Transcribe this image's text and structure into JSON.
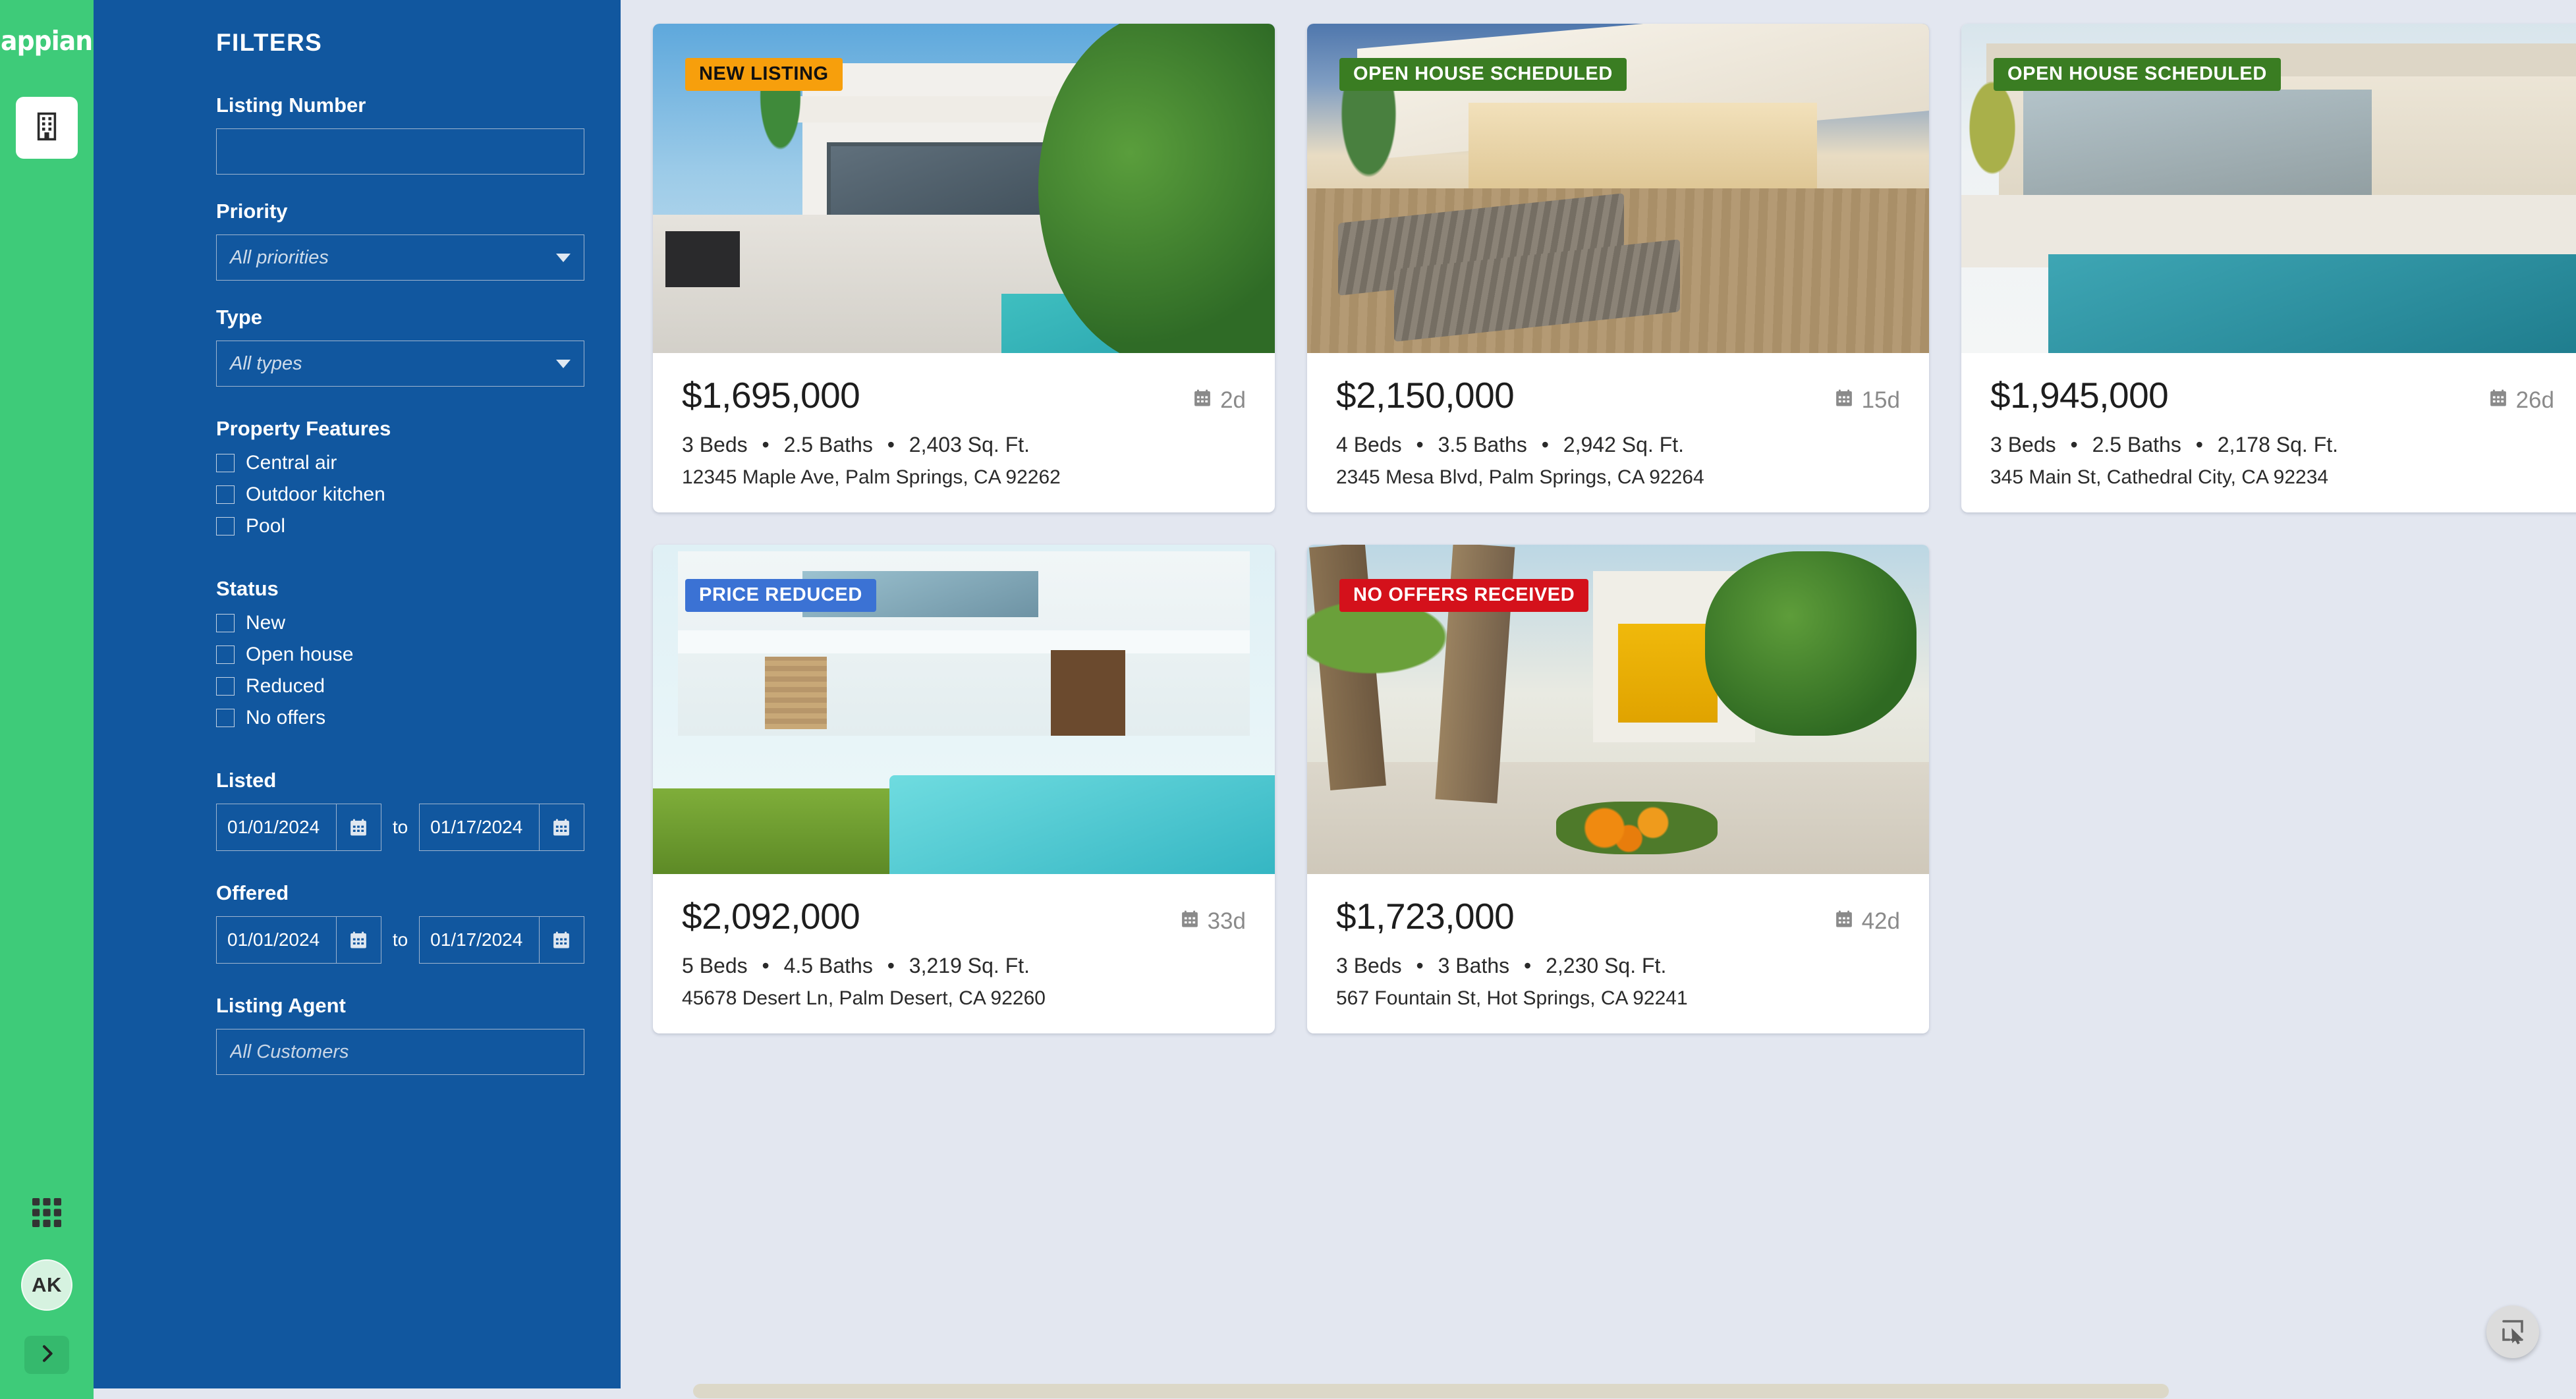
{
  "rail": {
    "logo": "appian",
    "app_icon": "building-icon",
    "grid_icon": "app-grid-icon",
    "avatar_initials": "AK",
    "expand_icon": "chevron-right-icon"
  },
  "filters": {
    "title": "FILTERS",
    "listing_number": {
      "label": "Listing Number",
      "value": "",
      "placeholder": ""
    },
    "priority": {
      "label": "Priority",
      "value": "All priorities"
    },
    "type": {
      "label": "Type",
      "value": "All types"
    },
    "property_features": {
      "label": "Property Features",
      "items": [
        {
          "label": "Central air",
          "checked": false
        },
        {
          "label": "Outdoor kitchen",
          "checked": false
        },
        {
          "label": "Pool",
          "checked": false
        }
      ]
    },
    "status": {
      "label": "Status",
      "items": [
        {
          "label": "New",
          "checked": false
        },
        {
          "label": "Open house",
          "checked": false
        },
        {
          "label": "Reduced",
          "checked": false
        },
        {
          "label": "No offers",
          "checked": false
        }
      ]
    },
    "listed": {
      "label": "Listed",
      "from": "01/01/2024",
      "to_label": "to",
      "to": "01/17/2024"
    },
    "offered": {
      "label": "Offered",
      "from": "01/01/2024",
      "to_label": "to",
      "to": "01/17/2024"
    },
    "listing_agent": {
      "label": "Listing Agent",
      "value": "",
      "placeholder": "All Customers"
    }
  },
  "colors": {
    "rail_green": "#3ecb79",
    "panel_blue": "#11579f",
    "page_bg": "#e3e7f0",
    "badge_new": "#f79f0c",
    "badge_open_house": "#3a7d22",
    "badge_reduced": "#3b72d4",
    "badge_no_offers": "#d4111b"
  },
  "listings": [
    {
      "badge": {
        "text": "NEW LISTING",
        "bg": "#f79f0c",
        "fg": "#111111"
      },
      "price": "$1,695,000",
      "days": "2d",
      "days_icon": "calendar-icon",
      "beds": "3 Beds",
      "baths": "2.5 Baths",
      "sqft": "2,403 Sq. Ft.",
      "address": "12345 Maple Ave, Palm Springs, CA 92262",
      "photo": "p1"
    },
    {
      "badge": {
        "text": "OPEN HOUSE SCHEDULED",
        "bg": "#3a7d22",
        "fg": "#ffffff"
      },
      "price": "$2,150,000",
      "days": "15d",
      "days_icon": "calendar-icon",
      "beds": "4 Beds",
      "baths": "3.5 Baths",
      "sqft": "2,942 Sq. Ft.",
      "address": "2345 Mesa Blvd, Palm Springs, CA 92264",
      "photo": "p2"
    },
    {
      "badge": {
        "text": "OPEN HOUSE SCHEDULED",
        "bg": "#3a7d22",
        "fg": "#ffffff"
      },
      "price": "$1,945,000",
      "days": "26d",
      "days_icon": "calendar-icon",
      "beds": "3 Beds",
      "baths": "2.5 Baths",
      "sqft": "2,178 Sq. Ft.",
      "address": "345 Main St, Cathedral City, CA 92234",
      "photo": "p3"
    },
    {
      "badge": {
        "text": "PRICE REDUCED",
        "bg": "#3b72d4",
        "fg": "#ffffff"
      },
      "price": "$2,092,000",
      "days": "33d",
      "days_icon": "calendar-icon",
      "beds": "5 Beds",
      "baths": "4.5 Baths",
      "sqft": "3,219 Sq. Ft.",
      "address": "45678 Desert Ln, Palm Desert, CA 92260",
      "photo": "p4"
    },
    {
      "badge": {
        "text": "NO OFFERS RECEIVED",
        "bg": "#d4111b",
        "fg": "#ffffff"
      },
      "price": "$1,723,000",
      "days": "42d",
      "days_icon": "calendar-icon",
      "beds": "3 Beds",
      "baths": "3 Baths",
      "sqft": "2,230 Sq. Ft.",
      "address": "567 Fountain St, Hot Springs, CA 92241",
      "photo": "p5"
    }
  ],
  "separator": "•",
  "fab": {
    "icon": "select-region-cursor-icon"
  }
}
